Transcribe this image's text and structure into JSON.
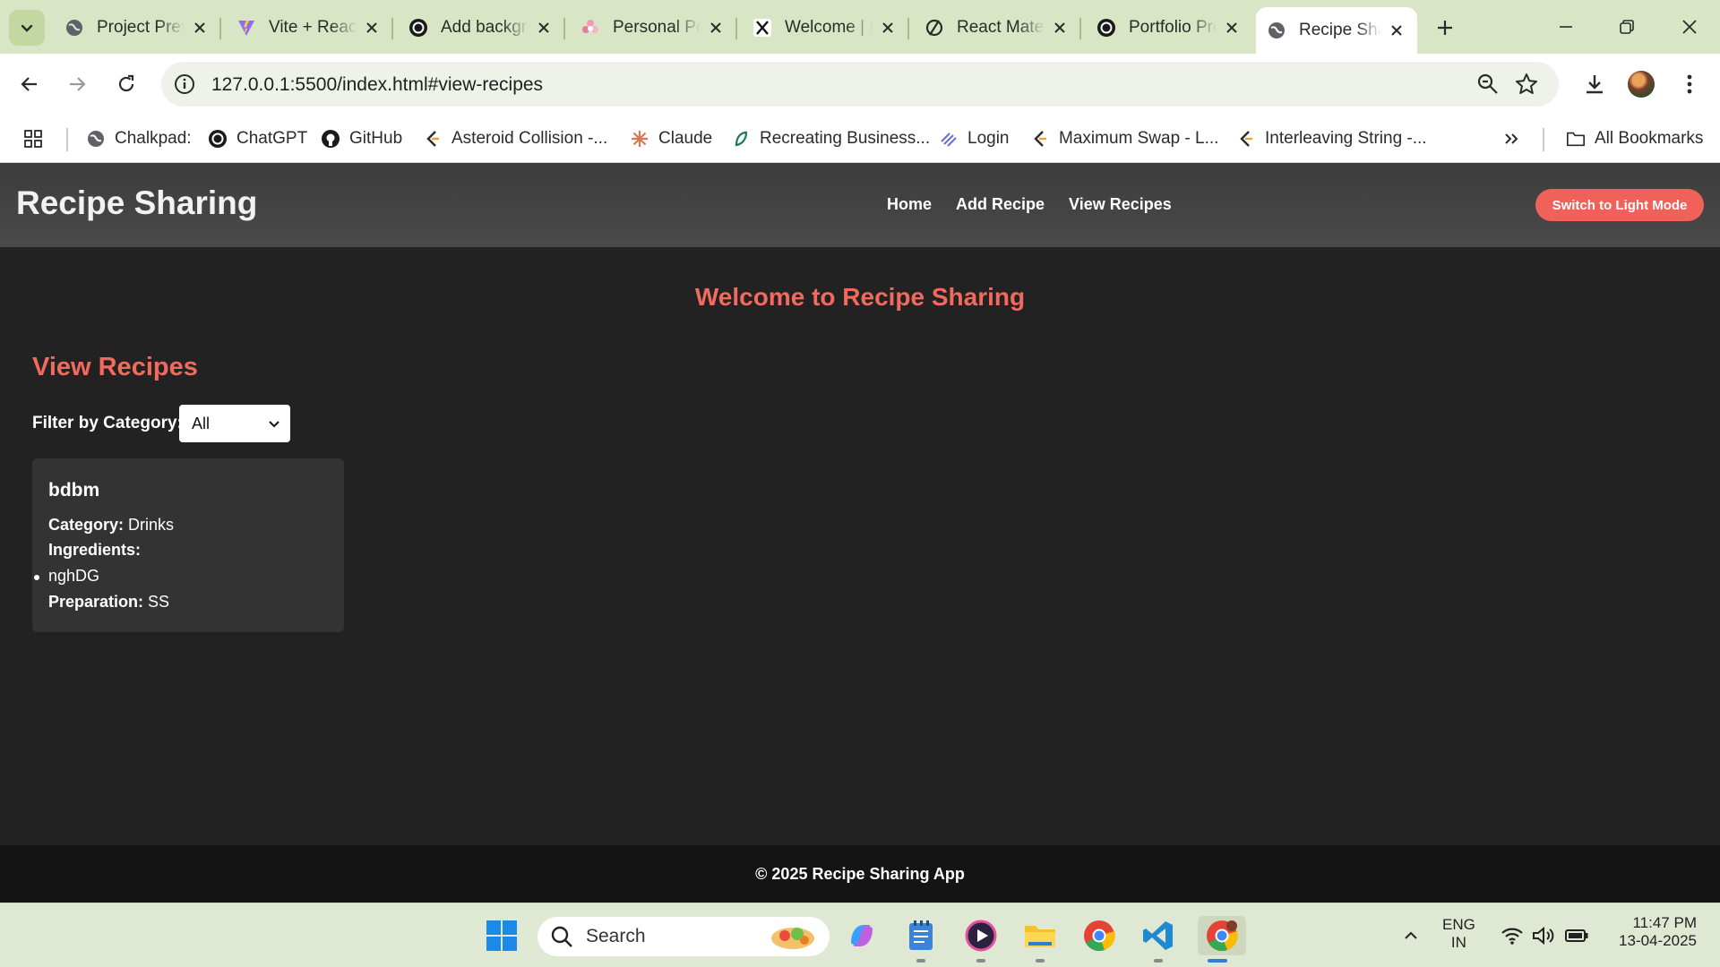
{
  "browser": {
    "tabs": [
      {
        "title": "Project Preview",
        "favicon": "globe-icon"
      },
      {
        "title": "Vite + React",
        "favicon": "vite-icon"
      },
      {
        "title": "Add background",
        "favicon": "openai-icon"
      },
      {
        "title": "Personal Portfolio",
        "favicon": "flower-icon"
      },
      {
        "title": "Welcome | Excalidraw",
        "favicon": "x-icon"
      },
      {
        "title": "React Material",
        "favicon": "slash-icon"
      },
      {
        "title": "Portfolio Project",
        "favicon": "openai-icon"
      },
      {
        "title": "Recipe Sharing",
        "favicon": "globe-icon"
      }
    ],
    "url": "127.0.0.1:5500/index.html#view-recipes",
    "bookmarks": [
      {
        "label": "Chalkpad:",
        "icon": "globe-icon"
      },
      {
        "label": "ChatGPT",
        "icon": "openai-icon"
      },
      {
        "label": "GitHub",
        "icon": "github-icon"
      },
      {
        "label": "Asteroid Collision -...",
        "icon": "leetcode-icon"
      },
      {
        "label": "Claude",
        "icon": "claude-icon"
      },
      {
        "label": "Recreating Business...",
        "icon": "leaf-icon"
      },
      {
        "label": "Login",
        "icon": "stripes-icon"
      },
      {
        "label": "Maximum Swap - L...",
        "icon": "leetcode-icon"
      },
      {
        "label": "Interleaving String -...",
        "icon": "leetcode-icon"
      }
    ],
    "all_bookmarks_label": "All Bookmarks"
  },
  "site": {
    "title": "Recipe Sharing",
    "nav": [
      "Home",
      "Add Recipe",
      "View Recipes"
    ],
    "theme_button": "Switch to Light Mode",
    "welcome": "Welcome to Recipe Sharing",
    "section_title": "View Recipes",
    "filter_label": "Filter by Category:",
    "filter_value": "All",
    "recipe": {
      "name": "bdbm",
      "category_label": "Category:",
      "category": "Drinks",
      "ingredients_label": "Ingredients:",
      "ingredients": [
        "nghDG"
      ],
      "preparation_label": "Preparation:",
      "preparation": "SS"
    },
    "footer": "© 2025 Recipe Sharing App",
    "accent_color": "#f06a5e",
    "background_color": "#222222"
  },
  "taskbar": {
    "search_placeholder": "Search",
    "language": "ENG",
    "region": "IN",
    "time": "11:47 PM",
    "date": "13-04-2025"
  }
}
